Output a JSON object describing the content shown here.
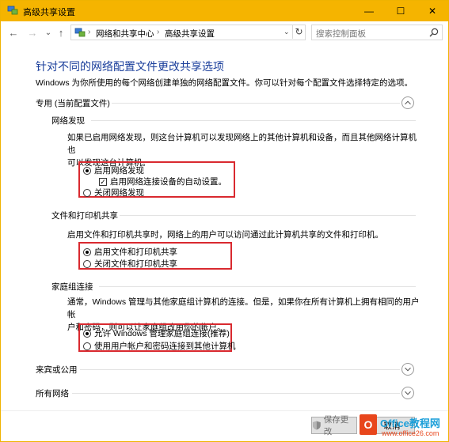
{
  "window": {
    "title": "高级共享设置",
    "controls": {
      "minimize": "—",
      "maximize": "☐",
      "close": "✕"
    }
  },
  "address": {
    "back": "←",
    "forward": "→",
    "recent": "⌄",
    "up": "↑",
    "crumbs": [
      "网络和共享中心",
      "高级共享设置"
    ],
    "separator": "›",
    "dropdown": "⌄",
    "refresh": "↻",
    "search_placeholder": "搜索控制面板"
  },
  "main": {
    "title": "针对不同的网络配置文件更改共享选项",
    "description": "Windows 为你所使用的每个网络创建单独的网络配置文件。你可以针对每个配置文件选择特定的选项。",
    "private_profile": {
      "label": "专用 (当前配置文件)",
      "network_discovery": {
        "label": "网络发现",
        "description_line1": "如果已启用网络发现，则这台计算机可以发现网络上的其他计算机和设备，而且其他网络计算机也",
        "description_line2": "可以发现这台计算机。",
        "options": [
          "启用网络发现",
          "启用网络连接设备的自动设置。",
          "关闭网络发现"
        ]
      },
      "file_printer_sharing": {
        "label": "文件和打印机共享",
        "description": "启用文件和打印机共享时，网络上的用户可以访问通过此计算机共享的文件和打印机。",
        "options": [
          "启用文件和打印机共享",
          "关闭文件和打印机共享"
        ]
      },
      "homegroup": {
        "label": "家庭组连接",
        "description_line1": "通常，Windows 管理与其他家庭组计算机的连接。但是，如果你在所有计算机上拥有相同的用户帐",
        "description_line2": "户和密码，则可以让家庭组改用你的帐户。",
        "options": [
          "允许 Windows 管理家庭组连接(推荐)",
          "使用用户帐户和密码连接到其他计算机"
        ]
      }
    },
    "guest_public": {
      "label": "来宾或公用"
    },
    "all_networks": {
      "label": "所有网络"
    }
  },
  "footer": {
    "save_label": "保存更改",
    "cancel_label": "取消"
  },
  "watermark": {
    "logo_text": "O",
    "brand": "Office教程网",
    "url": "www.office26.com"
  },
  "colors": {
    "titlebar": "#f5b400",
    "title_link": "#1a3e9b",
    "highlight_box": "#d9292f"
  }
}
